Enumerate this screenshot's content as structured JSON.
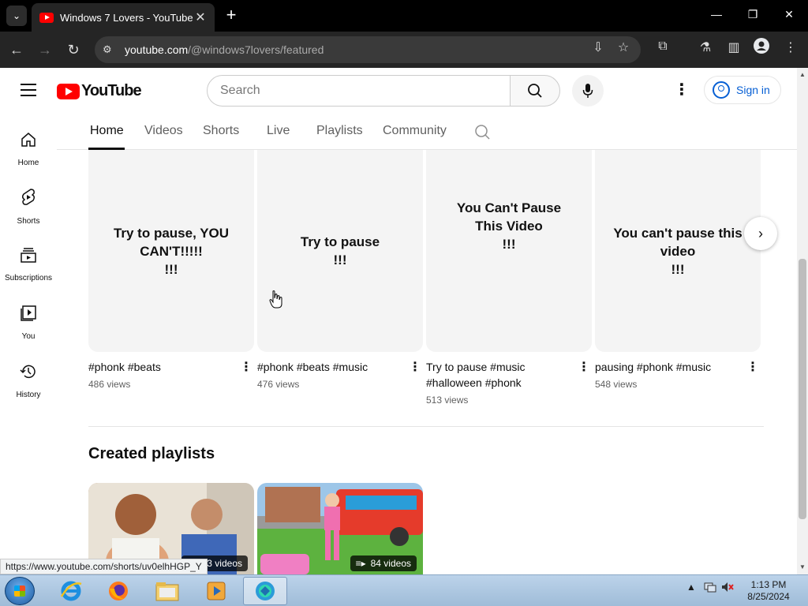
{
  "browser": {
    "tab_title": "Windows 7 Lovers - YouTube",
    "tab_close": "✕",
    "new_tab": "+",
    "url_host": "youtube.com",
    "url_path": "/@windows7lovers/featured",
    "window_minimize": "—",
    "window_restore": "❐",
    "window_close": "✕"
  },
  "masthead": {
    "logo_text": "YouTube",
    "search_placeholder": "Search",
    "sign_in_label": "Sign in",
    "more_icon": "⋮"
  },
  "rail": {
    "items": [
      {
        "label": "Home",
        "icon": "home-icon"
      },
      {
        "label": "Shorts",
        "icon": "shorts-icon"
      },
      {
        "label": "Subscriptions",
        "icon": "subscriptions-icon"
      },
      {
        "label": "You",
        "icon": "you-icon"
      },
      {
        "label": "History",
        "icon": "history-icon"
      }
    ]
  },
  "channel_tabs": [
    "Home",
    "Videos",
    "Shorts",
    "Live",
    "Playlists",
    "Community"
  ],
  "shorts": [
    {
      "thumb_line1": "Try to pause, YOU",
      "thumb_line2": "CAN'T!!!!!",
      "thumb_line3": "!!!",
      "title": "#phonk #beats",
      "views": "486 views"
    },
    {
      "thumb_line1": "Try to pause",
      "thumb_line2": "!!!",
      "thumb_line3": "",
      "title": "#phonk #beats #music",
      "views": "476 views"
    },
    {
      "thumb_line1": "You Can't Pause",
      "thumb_line2": "This Video",
      "thumb_line3": "!!!",
      "title": "Try to pause #music #halloween #phonk",
      "views": "513 views"
    },
    {
      "thumb_line1": "You can't pause this",
      "thumb_line2": "video",
      "thumb_line3": "!!!",
      "title": "pausing #phonk #music",
      "views": "548 views"
    }
  ],
  "playlists_section": {
    "title": "Created playlists",
    "items": [
      {
        "count": "23 videos"
      },
      {
        "count": "84 videos"
      }
    ]
  },
  "status_url": "https://www.youtube.com/shorts/uv0elhHGP_Y",
  "taskbar": {
    "time": "1:13 PM",
    "date": "8/25/2024",
    "tray_arrow": "▲"
  },
  "colors": {
    "youtube_red": "#ff0000",
    "link_blue": "#065fd4",
    "browser_dark": "#252525"
  }
}
